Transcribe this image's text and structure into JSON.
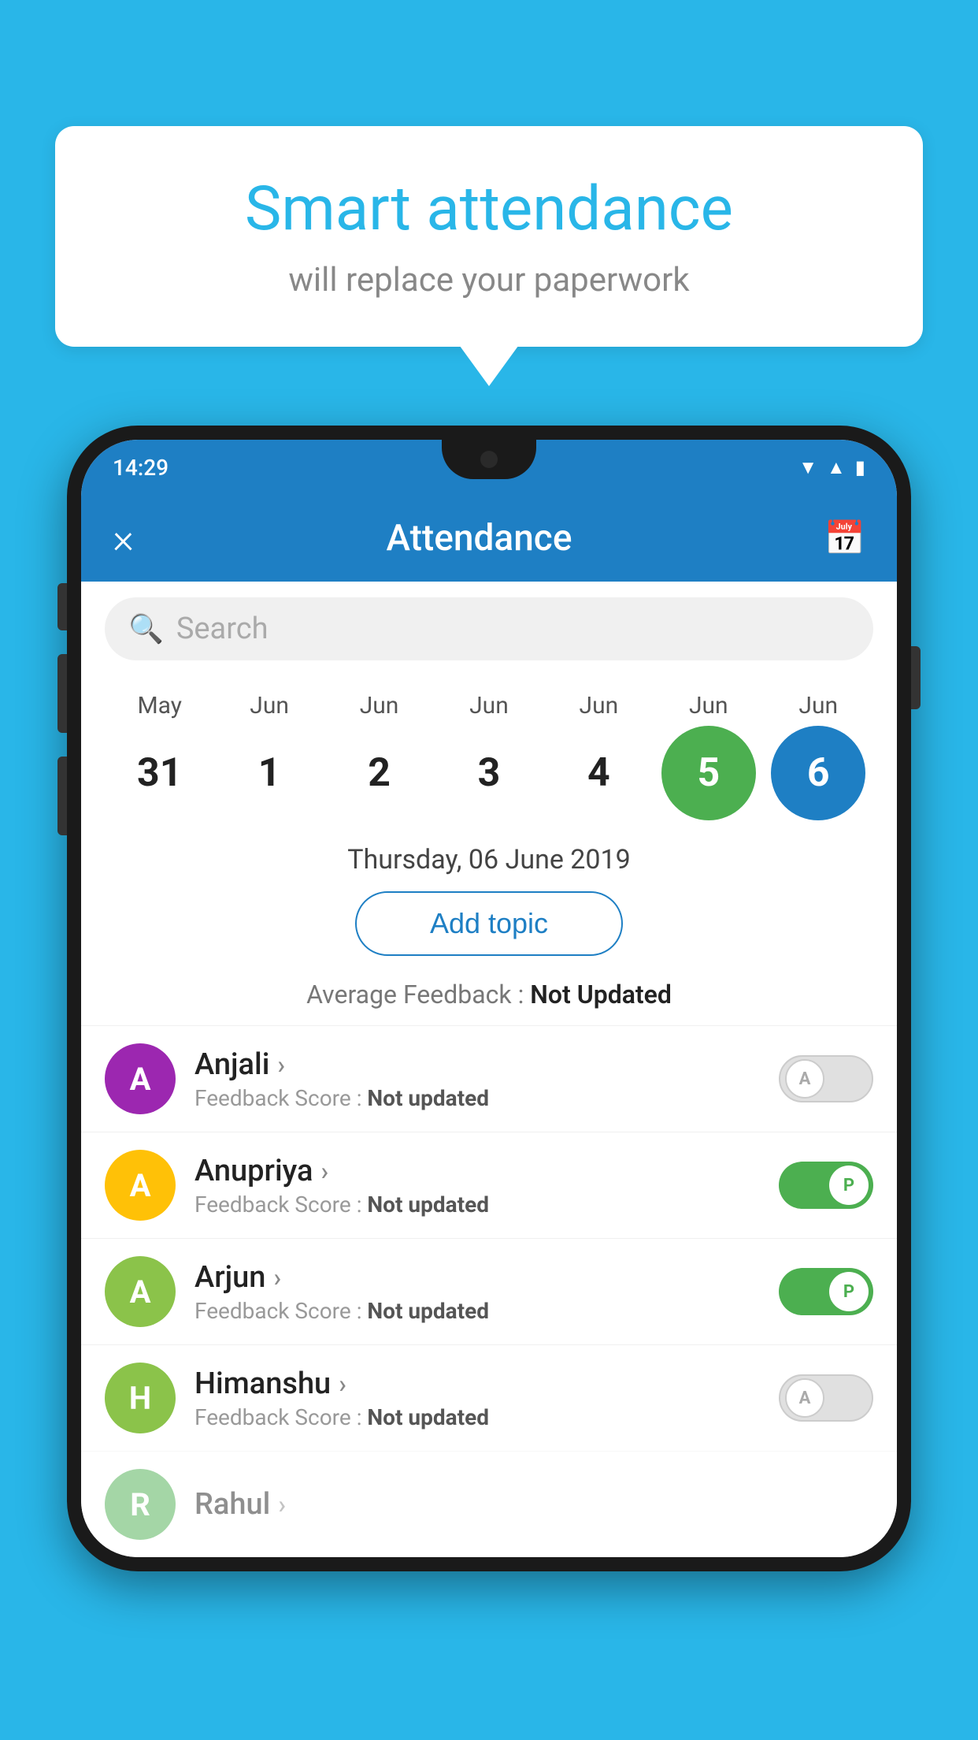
{
  "background_color": "#29b6e8",
  "bubble": {
    "title": "Smart attendance",
    "subtitle": "will replace your paperwork"
  },
  "app": {
    "status_time": "14:29",
    "toolbar_title": "Attendance",
    "close_label": "×",
    "calendar_icon": "📅"
  },
  "search": {
    "placeholder": "Search"
  },
  "calendar": {
    "months": [
      "May",
      "Jun",
      "Jun",
      "Jun",
      "Jun",
      "Jun",
      "Jun"
    ],
    "dates": [
      "31",
      "1",
      "2",
      "3",
      "4",
      "5",
      "6"
    ],
    "today_index": 5,
    "selected_index": 6
  },
  "date_label": "Thursday, 06 June 2019",
  "add_topic_label": "Add topic",
  "feedback_avg_label": "Average Feedback : ",
  "feedback_avg_value": "Not Updated",
  "students": [
    {
      "name": "Anjali",
      "avatar_letter": "A",
      "avatar_color": "#9c27b0",
      "feedback_label": "Feedback Score : ",
      "feedback_value": "Not updated",
      "status": "absent"
    },
    {
      "name": "Anupriya",
      "avatar_letter": "A",
      "avatar_color": "#ffc107",
      "feedback_label": "Feedback Score : ",
      "feedback_value": "Not updated",
      "status": "present"
    },
    {
      "name": "Arjun",
      "avatar_letter": "A",
      "avatar_color": "#8bc34a",
      "feedback_label": "Feedback Score : ",
      "feedback_value": "Not updated",
      "status": "present"
    },
    {
      "name": "Himanshu",
      "avatar_letter": "H",
      "avatar_color": "#8bc34a",
      "feedback_label": "Feedback Score : ",
      "feedback_value": "Not updated",
      "status": "absent"
    }
  ]
}
